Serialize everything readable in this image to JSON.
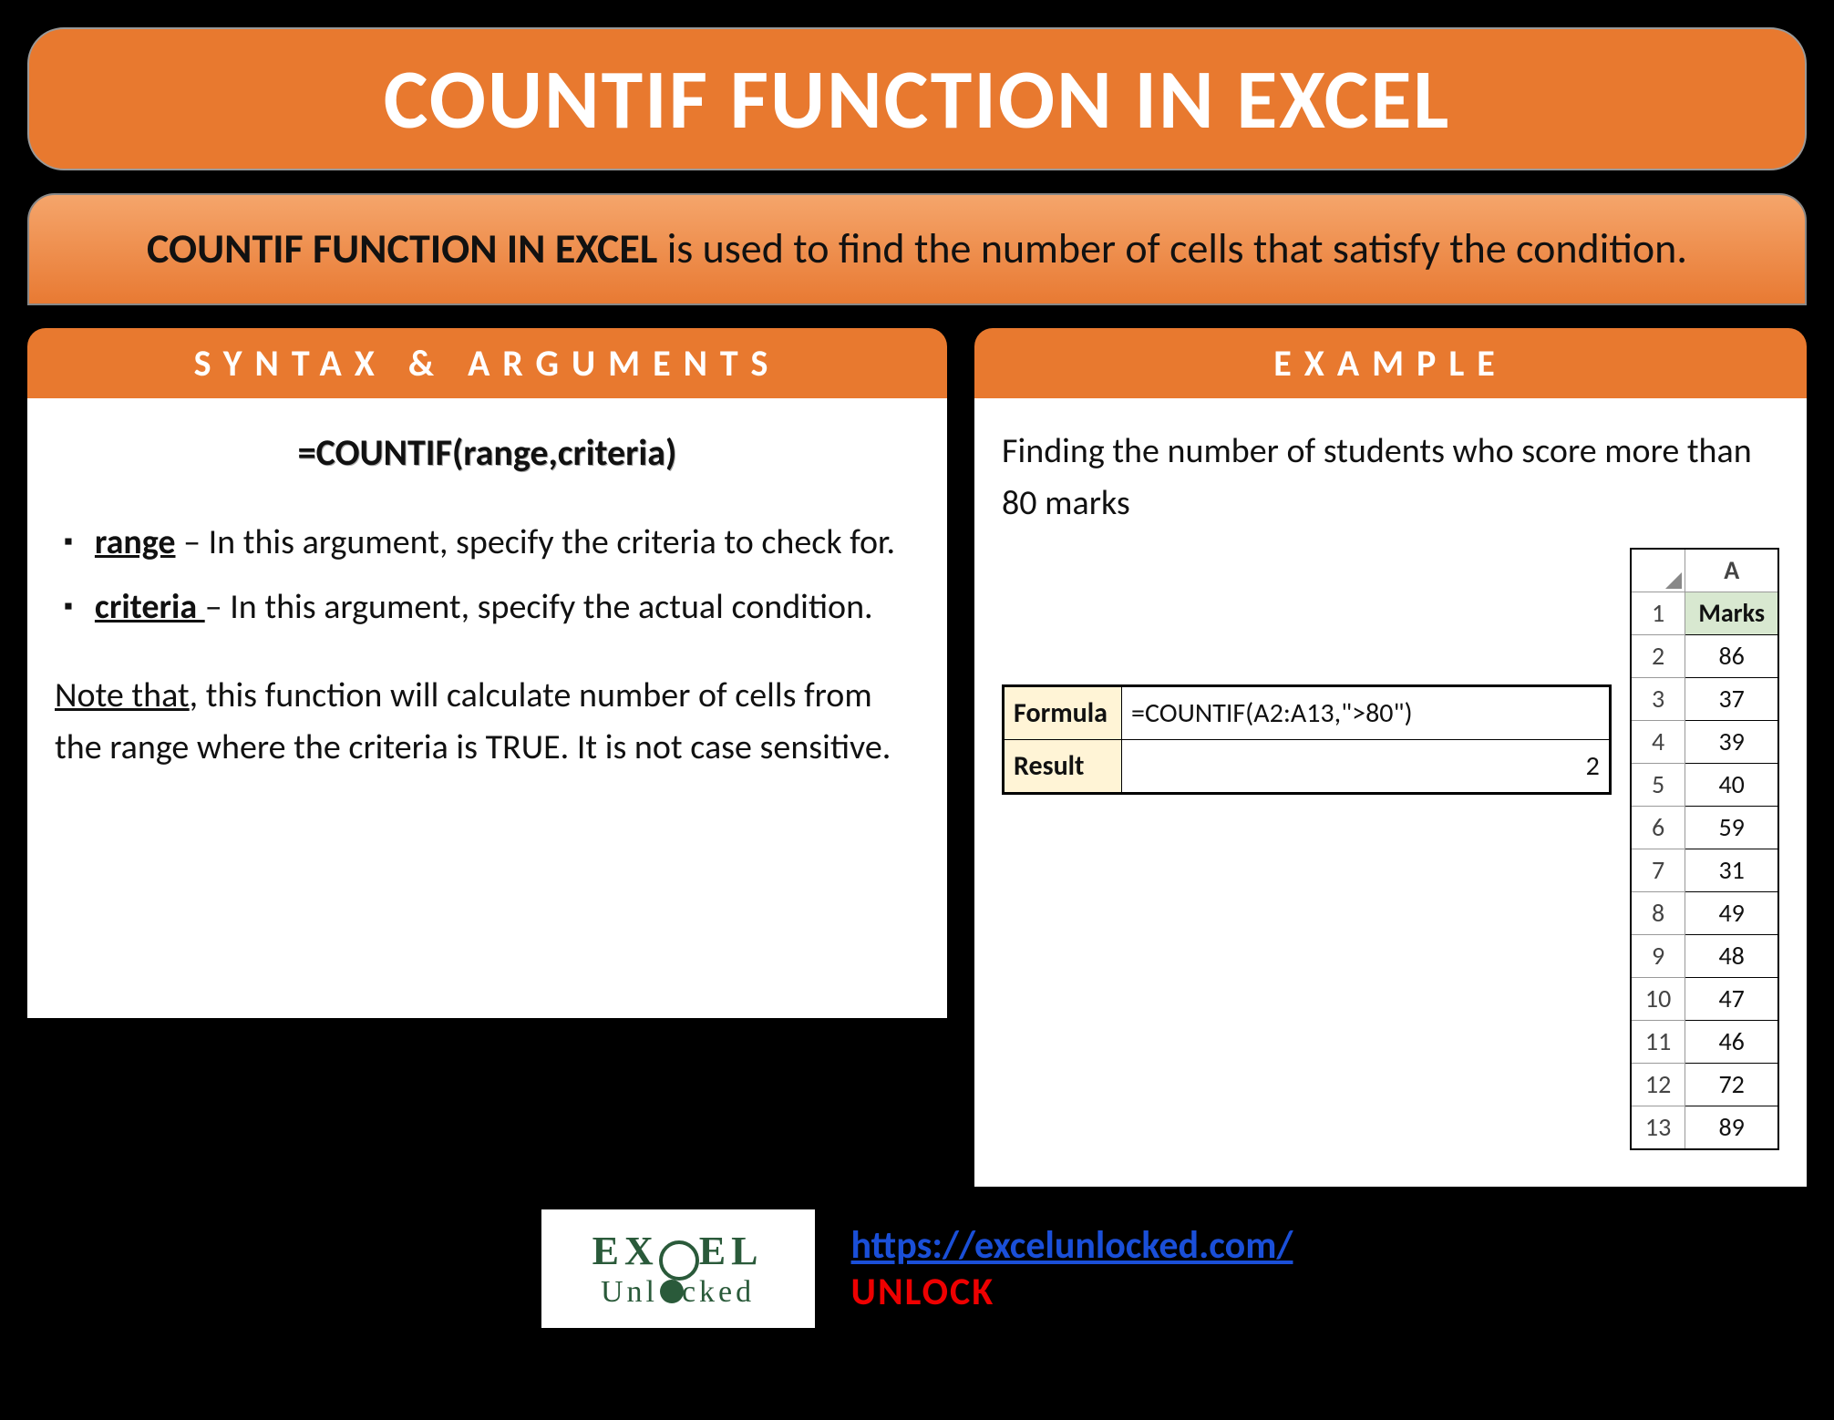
{
  "title": "COUNTIF FUNCTION IN EXCEL",
  "description": {
    "bold": "COUNTIF FUNCTION IN EXCEL",
    "rest": " is used to find the number of cells that satisfy the condition."
  },
  "syntax": {
    "header": "SYNTAX & ARGUMENTS",
    "formula": "=COUNTIF(range,criteria)",
    "args": [
      {
        "name": "range",
        "text": " – In this argument, specify the criteria to check for."
      },
      {
        "name": "criteria ",
        "text": "– In this argument, specify the actual condition."
      }
    ],
    "note_label": "Note that",
    "note_text": ", this function will calculate number of cells from the range where the criteria is TRUE. It is not case sensitive."
  },
  "example": {
    "header": "EXAMPLE",
    "desc": "Finding the number of students who score more than 80 marks",
    "formula_label": "Formula",
    "formula_value": "=COUNTIF(A2:A13,\">80\")",
    "result_label": "Result",
    "result_value": "2",
    "column_letter": "A",
    "marks_header": "Marks",
    "marks": [
      "86",
      "37",
      "39",
      "40",
      "59",
      "31",
      "49",
      "48",
      "47",
      "46",
      "72",
      "89"
    ],
    "row_nums": [
      "1",
      "2",
      "3",
      "4",
      "5",
      "6",
      "7",
      "8",
      "9",
      "10",
      "11",
      "12",
      "13"
    ]
  },
  "footer": {
    "logo_line1": "EXCEL",
    "logo_line2": "Unl   cked",
    "url": "https://excelunlocked.com/",
    "unlock": "UNLOCK"
  }
}
